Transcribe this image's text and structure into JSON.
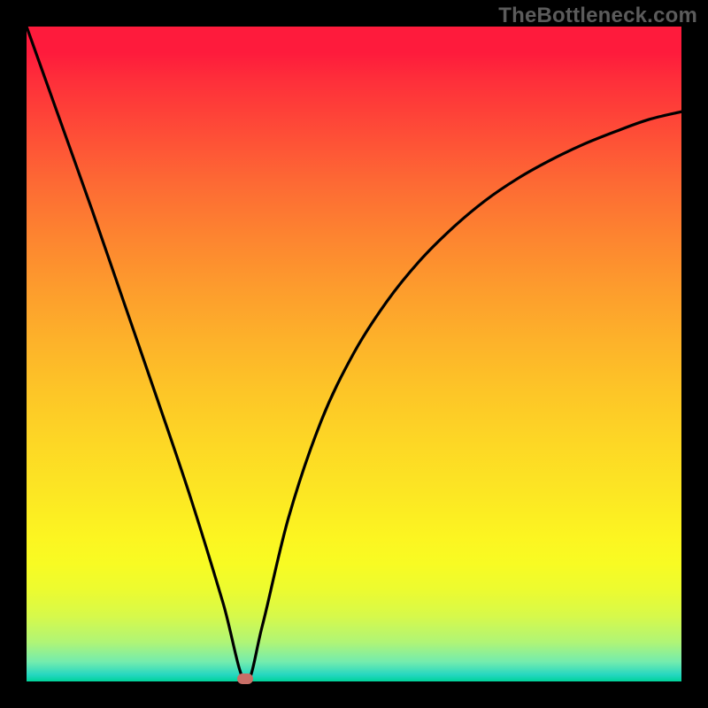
{
  "watermark": "TheBottleneck.com",
  "chart_data": {
    "type": "line",
    "title": "",
    "xlabel": "",
    "ylabel": "",
    "xlim": [
      0,
      1
    ],
    "ylim": [
      0,
      1
    ],
    "series": [
      {
        "name": "bottleneck-curve",
        "x": [
          0.0,
          0.05,
          0.1,
          0.15,
          0.2,
          0.25,
          0.3,
          0.334,
          0.36,
          0.4,
          0.45,
          0.5,
          0.55,
          0.6,
          0.65,
          0.7,
          0.75,
          0.8,
          0.85,
          0.9,
          0.95,
          1.0
        ],
        "y": [
          1.0,
          0.86,
          0.72,
          0.575,
          0.43,
          0.282,
          0.12,
          0.0,
          0.085,
          0.25,
          0.398,
          0.502,
          0.58,
          0.642,
          0.692,
          0.734,
          0.768,
          0.796,
          0.82,
          0.84,
          0.858,
          0.87
        ]
      }
    ],
    "annotations": [
      {
        "name": "optimal-point",
        "x": 0.334,
        "y": 0.0
      }
    ],
    "gradient_colors": {
      "top": "#fe1b3c",
      "mid": "#fdd825",
      "bottom": "#00d39a"
    }
  }
}
